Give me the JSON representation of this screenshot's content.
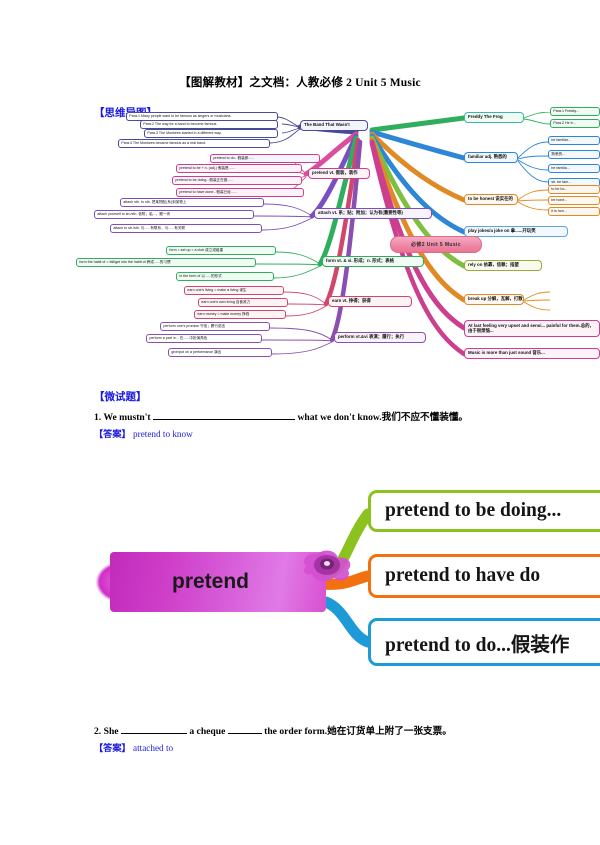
{
  "document": {
    "title": "【图解教材】之文档：人教必修 2 Unit 5 Music",
    "mindmap_heading": "【思维导图】",
    "quiz_heading": "【微试题】"
  },
  "mindmap": {
    "center": "必修2  Unit 5  Music",
    "branches": [
      {
        "name": "the-band-that-wasnt",
        "color": "#4a4a9c",
        "label": "The Band That Wasn't",
        "children": [
          "Para.1 Many people want to be famous as singers or musicians.",
          "Para.2 The way for a band to become famous.",
          "Para.3 The Monkees started in a different way.",
          "Para.4 The Monkees became famous as a real band."
        ]
      },
      {
        "name": "pretend",
        "color": "#d94f9e",
        "label": "pretend vt. 假装，装作",
        "children": [
          "pretend to do...假装即......",
          "pretend to be + n. (adj.) 假装是......",
          "pretend to be doing...假装正在做......",
          "pretend to have done...假装已经......"
        ]
      },
      {
        "name": "attach",
        "color": "#7a4fbf",
        "label": "attach vt. 系；贴；附加；认为有(重要性等)",
        "children": [
          "attach sth. to sth. 把某物贴(系)到某物上",
          "attach yourself to sb./sth. 依附；粘...，跟一块",
          "attach to sb./sth. 与......有联系，与......有关联"
        ]
      },
      {
        "name": "form",
        "color": "#2fae5e",
        "label": "form vt. & vi. 形成；n. 形式；表格",
        "children": [
          "form = set up = a club 成立或组建",
          "form the habit of = fall/get into the habit of 养成......的习惯",
          "in the form of 以......的形式"
        ]
      },
      {
        "name": "earn",
        "color": "#d1476b",
        "label": "earn vt. 挣得；获得",
        "children": [
          "earn one's living = make a living 谋生",
          "earn one's own living 自食其力",
          "earn money = make money 挣钱"
        ]
      },
      {
        "name": "perform",
        "color": "#8a4fb0",
        "label": "perform vt.&vi 表演；履行；执行",
        "children": [
          "perform one's promise 守信；履行诺言",
          "perform a part in... 在......中扮演角色",
          "give/put on a performance 演出"
        ]
      },
      {
        "name": "freddy-the-frog",
        "color": "#2fae5e",
        "label": "Freddy The Frog",
        "children": [
          "Para.1 Freddy...",
          "Para.2 He tr..."
        ]
      },
      {
        "name": "familiar",
        "color": "#2d86d6",
        "label": "familiar adj. 熟悉的",
        "children": [
          "be familiar...",
          "熟悉的...",
          "be familia...",
          "person：sb. fam...",
          "sb. be fam..."
        ]
      },
      {
        "name": "to-be-honest",
        "color": "#e08a26",
        "label": "to be honest 说实在的",
        "children": [
          "to be ho...",
          "be hone...",
          "it is hon..."
        ]
      },
      {
        "name": "play-jokes-on",
        "color": "#2d86d6",
        "label": "play jokes/a joke on 拿......开玩笑",
        "children": []
      },
      {
        "name": "rely-on",
        "color": "#7fbf3f",
        "label": "rely on 依靠，信赖；指望",
        "children": []
      },
      {
        "name": "break-up",
        "color": "#e08a26",
        "label": "break up 分解，瓦解，打散",
        "children": []
      },
      {
        "name": "at-last-feeling",
        "color": "#cc3f8f",
        "label": "At last feeling very upset and sensi... painful for them.总的，由于很烦恼...",
        "children": []
      },
      {
        "name": "music-is-more-than",
        "color": "#cc3f8f",
        "label": "Music is more than just sound 音乐...",
        "children": []
      }
    ]
  },
  "pretend_diagram": {
    "center": "pretend",
    "branches": [
      {
        "label": "pretend to be doing...",
        "color": "#8cc21f"
      },
      {
        "label": "pretend to have do",
        "color": "#f3700f"
      },
      {
        "label": "pretend to do...假装作",
        "color": "#1e9ad6"
      }
    ]
  },
  "quiz": {
    "items": [
      {
        "number": "1.",
        "text_before": "We mustn't",
        "text_after": "what we don't know.我们不应不懂装懂。",
        "answer_tag": "【答案】",
        "answer": "pretend to know"
      },
      {
        "number": "2.",
        "text_before": "She",
        "text_mid": "a cheque",
        "text_after": "the order form.她在订货单上附了一张支票。",
        "answer_tag": "【答案】",
        "answer": "attached to"
      }
    ]
  }
}
